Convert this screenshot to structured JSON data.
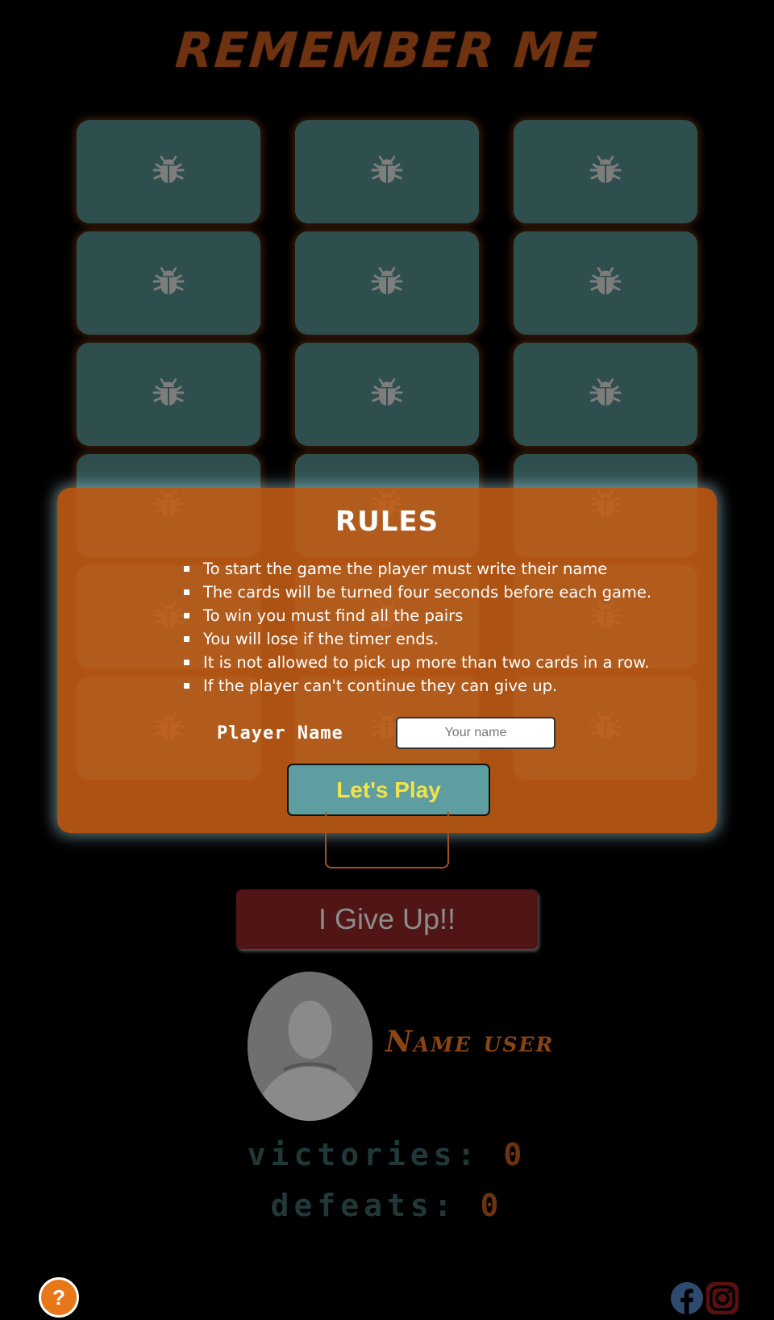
{
  "title": "REMEMBER ME",
  "cards": [
    {
      "icon": "bug-icon"
    },
    {
      "icon": "bug-icon"
    },
    {
      "icon": "bug-icon"
    },
    {
      "icon": "bug-icon"
    },
    {
      "icon": "bug-icon"
    },
    {
      "icon": "bug-icon"
    },
    {
      "icon": "bug-icon"
    },
    {
      "icon": "bug-icon"
    },
    {
      "icon": "bug-icon"
    },
    {
      "icon": "bug-icon"
    },
    {
      "icon": "bug-icon"
    },
    {
      "icon": "bug-icon"
    },
    {
      "icon": "bug-icon"
    },
    {
      "icon": "bug-icon"
    },
    {
      "icon": "bug-icon"
    },
    {
      "icon": "bug-icon"
    },
    {
      "icon": "bug-icon"
    },
    {
      "icon": "bug-icon"
    }
  ],
  "rules_modal": {
    "title": "RULES",
    "rules": [
      "To start the game the player must write their name",
      "The cards will be turned four seconds before each game.",
      "To win you must find all the pairs",
      "You will lose if the timer ends.",
      "It is not allowed to pick up more than two cards in a row.",
      "If the player can't continue they can give up."
    ],
    "player_label": "Player Name",
    "name_placeholder": "Your name",
    "name_value": "",
    "play_button": "Let's Play"
  },
  "give_up_button": "I Give Up!!",
  "user": {
    "name": "Name user",
    "avatar_icon": "user-avatar-icon"
  },
  "stats": {
    "victories_label": "victories:",
    "victories": "0",
    "defeats_label": "defeats:",
    "defeats": "0"
  },
  "footer": {
    "help_label": "?",
    "social": [
      "facebook-icon",
      "instagram-icon"
    ]
  },
  "colors": {
    "background": "#000000",
    "card": "#2f4f4f",
    "modal": "#c45d16",
    "play_button": "#5f9ea0",
    "play_text": "#f3e24a",
    "give_up": "#521515",
    "facebook": "#2d4b6e",
    "instagram": "#5a1010"
  }
}
